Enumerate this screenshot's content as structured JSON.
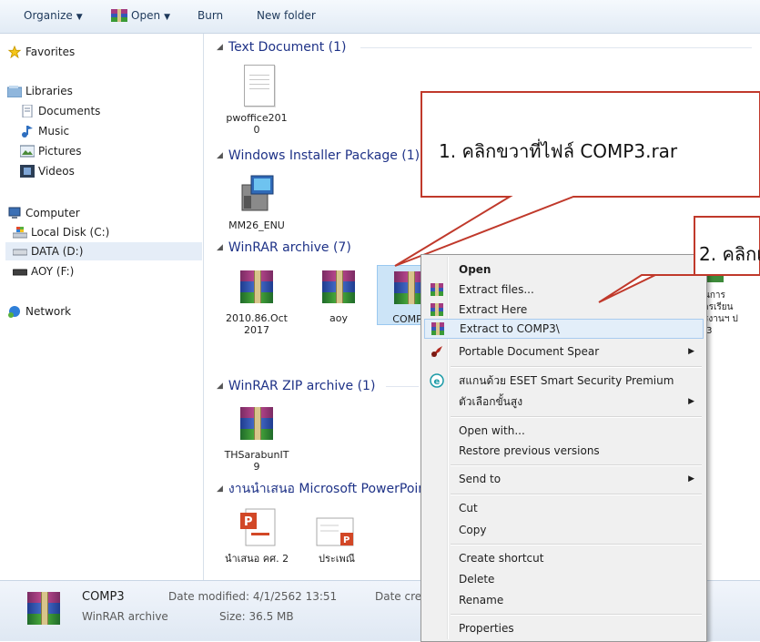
{
  "toolbar": {
    "organize": "Organize",
    "open": "Open",
    "burn": "Burn",
    "new_folder": "New folder"
  },
  "nav": {
    "favorites": "Favorites",
    "libraries": "Libraries",
    "documents": "Documents",
    "music": "Music",
    "pictures": "Pictures",
    "videos": "Videos",
    "computer": "Computer",
    "local_disk": "Local Disk (C:)",
    "data_drive": "DATA (D:)",
    "aoy_drive": "AOY (F:)",
    "network": "Network"
  },
  "groups": {
    "text_doc": "Text Document (1)",
    "installer": "Windows Installer Package (1)",
    "winrar": "WinRAR archive (7)",
    "winrar_zip": "WinRAR ZIP archive (1)",
    "ppt": "งานนำเสนอ Microsoft PowerPoint"
  },
  "files": {
    "pwoffice": "pwoffice2010",
    "mm26": "MM26_ENU",
    "r2010": "2010.86.Oct 2017",
    "aoy": "aoy",
    "comp3": "COMP3",
    "thsarabun": "THSarabunIT9",
    "ppt1": "นำเสนอ คศ. 2",
    "ppt2": "ประเพณี",
    "partial_right": "นการ\nารเรียน\nรงานฯ ป\n.3"
  },
  "status": {
    "name": "COMP3",
    "type": "WinRAR archive",
    "modified_label": "Date modified: 4/1/2562 13:51",
    "size_label": "Size: 36.5 MB",
    "created_label": "Date creat"
  },
  "context_menu": {
    "open": "Open",
    "extract_files": "Extract files...",
    "extract_here": "Extract Here",
    "extract_to": "Extract to COMP3\\",
    "portable_doc": "Portable Document Spear",
    "eset_scan": "สแกนด้วย ESET Smart Security Premium",
    "advanced": "ตัวเลือกขั้นสูง",
    "open_with": "Open with...",
    "restore": "Restore previous versions",
    "send_to": "Send to",
    "cut": "Cut",
    "copy": "Copy",
    "create_shortcut": "Create shortcut",
    "delete": "Delete",
    "rename": "Rename",
    "properties": "Properties"
  },
  "callouts": {
    "step1": "1.  คลิกขวาที่ไฟล์ COMP3.rar",
    "step2": "2. คลิกแถบตัวเลื"
  }
}
